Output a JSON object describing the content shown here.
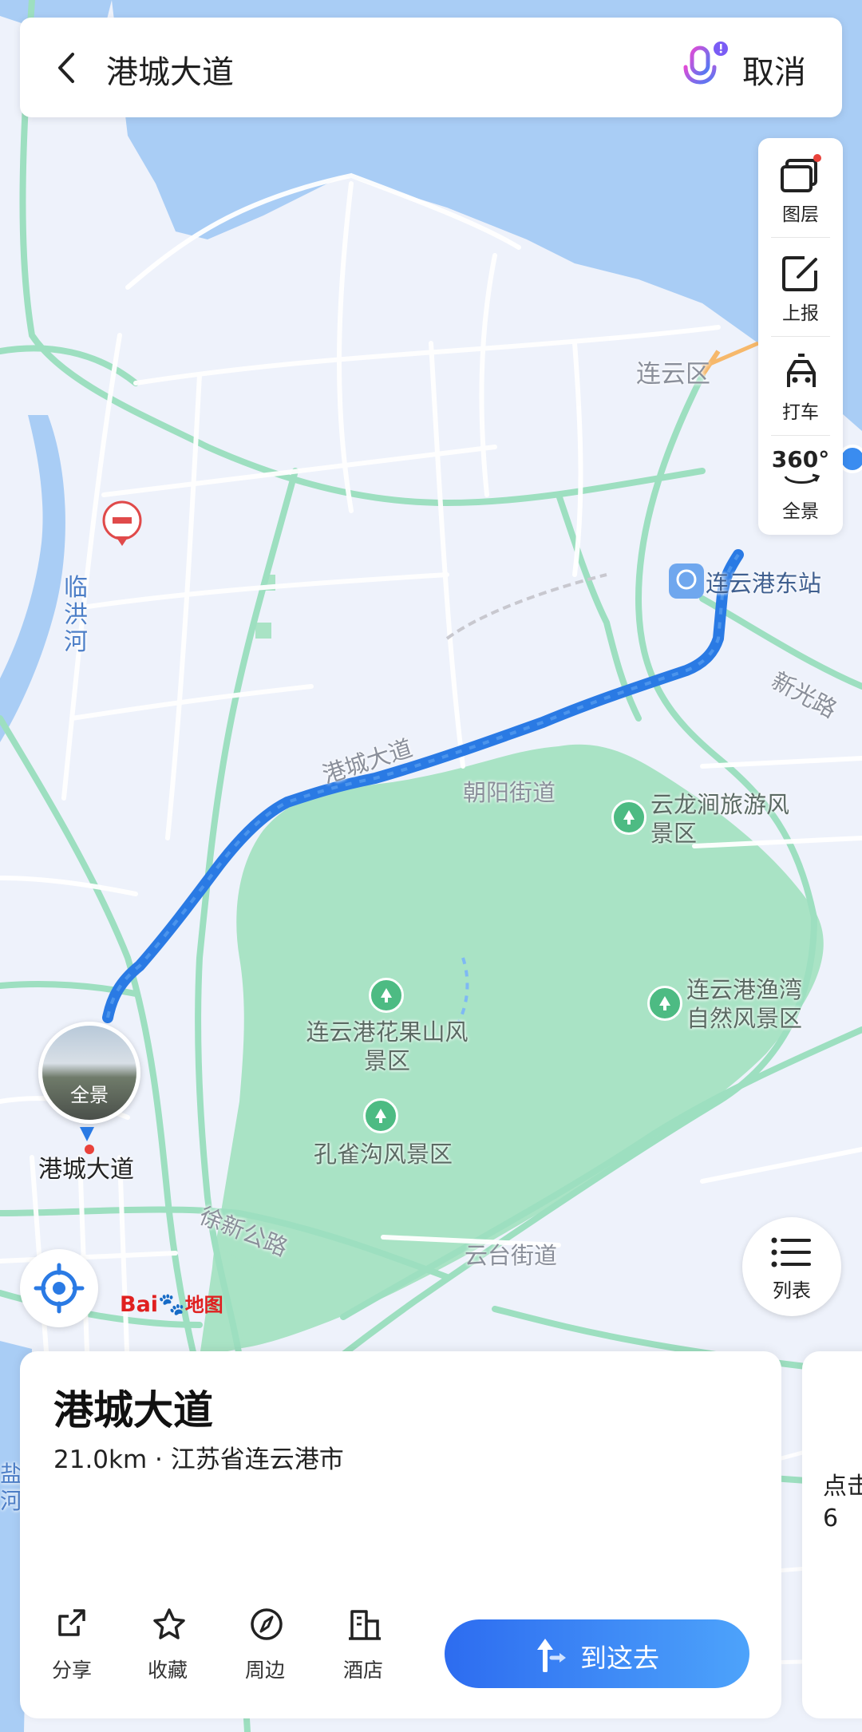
{
  "search": {
    "query": "港城大道",
    "cancel_label": "取消"
  },
  "toolbar": {
    "layers_label": "图层",
    "report_label": "上报",
    "taxi_label": "打车",
    "panorama_label": "全景",
    "panorama_badge": "360°"
  },
  "map": {
    "labels": {
      "district": "连云区",
      "river_linhong": "临洪河",
      "station": "连云港东站",
      "road_xinguang": "新光路",
      "road_gangcheng": "港城大道",
      "street_chaoyang": "朝阳街道",
      "scenic_yunlongjian": "云龙涧旅游风景区",
      "scenic_yuwan": "连云港渔湾自然风景区",
      "scenic_huaguoshan": "连云港花果山风景区",
      "scenic_kongquegou": "孔雀沟风景区",
      "road_xuxin": "徐新公路",
      "street_yuntai": "云台街道",
      "river_left": "盐河"
    },
    "streetview_label": "全景",
    "pin_label": "港城大道",
    "list_label": "列表",
    "logo": "Bai地图"
  },
  "place_card": {
    "name": "港城大道",
    "meta": "21.0km · 江苏省连云港市",
    "actions": [
      {
        "label": "分享",
        "icon": "share-icon"
      },
      {
        "label": "收藏",
        "icon": "star-icon"
      },
      {
        "label": "周边",
        "icon": "compass-icon"
      },
      {
        "label": "酒店",
        "icon": "hotel-icon"
      }
    ],
    "go_label": "到这去"
  },
  "next_card_peek": "点击\n6",
  "colors": {
    "route": "#2a7ae4",
    "park": "#a9e3c5",
    "water": "#a9cdf5",
    "road": "#9ddfc0",
    "accent": "#2d6cf0"
  }
}
